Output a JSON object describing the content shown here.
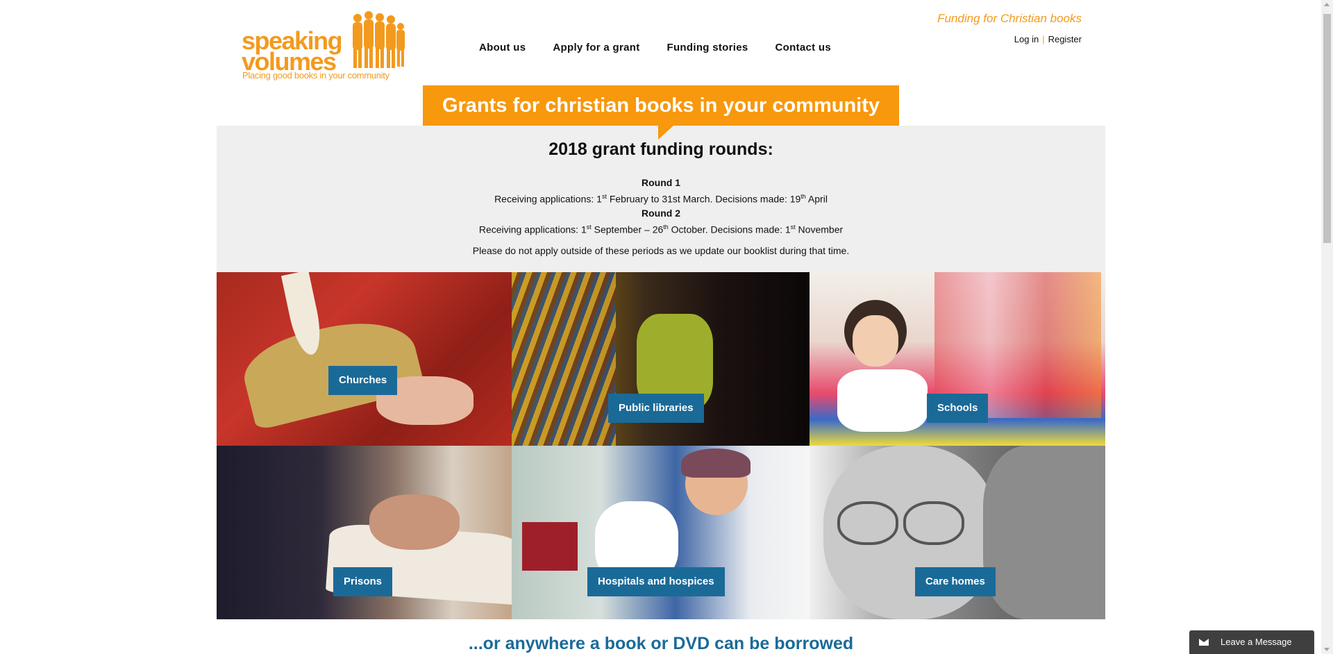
{
  "logo": {
    "name": "speaking volumes",
    "line1": "speaking",
    "line2": "volumes",
    "tagline": "Placing good books in your community"
  },
  "nav": [
    {
      "label": "About us"
    },
    {
      "label": "Apply for a grant"
    },
    {
      "label": "Funding stories"
    },
    {
      "label": "Contact us"
    }
  ],
  "header": {
    "tagline": "Funding for Christian books",
    "login": "Log in",
    "separator": "|",
    "register": "Register"
  },
  "banner": {
    "title": "Grants for christian books in your community"
  },
  "info": {
    "heading": "2018 grant funding rounds:",
    "round1_title": "Round 1",
    "round1_text_a": "Receiving applications: 1",
    "round1_sup_a": "st",
    "round1_text_b": " February to 31st March. Decisions made: 19",
    "round1_sup_b": "th",
    "round1_text_c": " April",
    "round2_title": "Round 2",
    "round2_text_a": "Receiving applications: 1",
    "round2_sup_a": "st",
    "round2_text_b": " September – 26",
    "round2_sup_b": "th",
    "round2_text_c": " October. Decisions made: 1",
    "round2_sup_c": "st",
    "round2_text_d": " November",
    "note": "Please do not apply outside of these periods as we update our booklist during that time."
  },
  "tiles": [
    {
      "label": "Churches"
    },
    {
      "label": "Public libraries"
    },
    {
      "label": "Schools"
    },
    {
      "label": "Prisons"
    },
    {
      "label": "Hospitals and hospices"
    },
    {
      "label": "Care homes"
    }
  ],
  "footer": {
    "tagline": "...or anywhere a book or DVD can be borrowed"
  },
  "chat": {
    "label": "Leave a Message"
  },
  "colors": {
    "brand_orange": "#f7980d",
    "button_blue": "#1a6a98",
    "info_bg": "#efefef"
  }
}
